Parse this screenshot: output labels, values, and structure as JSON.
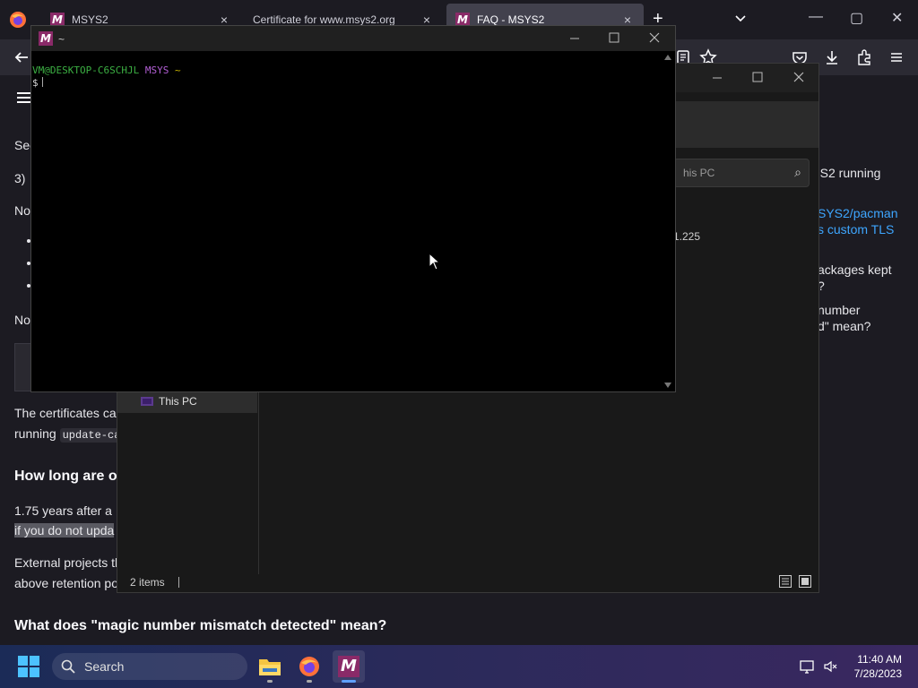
{
  "browser": {
    "tabs": [
      {
        "title": "MSYS2",
        "close": "×"
      },
      {
        "title": "Certificate for www.msys2.org",
        "close": "×"
      },
      {
        "title": "FAQ - MSYS2",
        "close": "×"
      }
    ],
    "new_tab": "+",
    "window_controls": {
      "minimize": "—",
      "maximize": "▢",
      "close": "✕"
    }
  },
  "page": {
    "left_fragments": {
      "sec": "Sec",
      "three": "3) ",
      "no1": "No",
      "no2": "No",
      "certificates": "The certificates ca",
      "running": "running ",
      "update_code": "update-ca",
      "heading_how_long": "How long are ol",
      "years": "1.75 years after a ",
      "highlight": "if you do not upda",
      "external": "External projects th",
      "retention": "above retention po",
      "heading_magic": "What does \"magic number mismatch detected\" mean?"
    },
    "right_fragments": {
      "running": "'S2 running",
      "pacman": "SYS2/pacman",
      "custom_tls": "s custom TLS",
      "packages_kept": "ackages kept",
      "q_mark": "?",
      "number": "number",
      "mean": "d\" mean?"
    }
  },
  "explorer": {
    "search_placeholder": "his PC",
    "search_icon_glyph": "⌕",
    "ip_fragment": "1.225",
    "sidebar_this_pc": "This PC",
    "status_items": "2 items"
  },
  "terminal": {
    "title": "~",
    "user_host": "VM@DESKTOP-C6SCHJL",
    "system": "MSYS",
    "path": "~",
    "prompt": "$"
  },
  "taskbar": {
    "search_label": "Search",
    "time": "11:40 AM",
    "date": "7/28/2023"
  },
  "colors": {
    "terminal_user": "#3cb043",
    "terminal_system": "#b35fd6",
    "terminal_path": "#c8b400",
    "link": "#3ea6ff",
    "msys_brand": "#8a2a68"
  }
}
